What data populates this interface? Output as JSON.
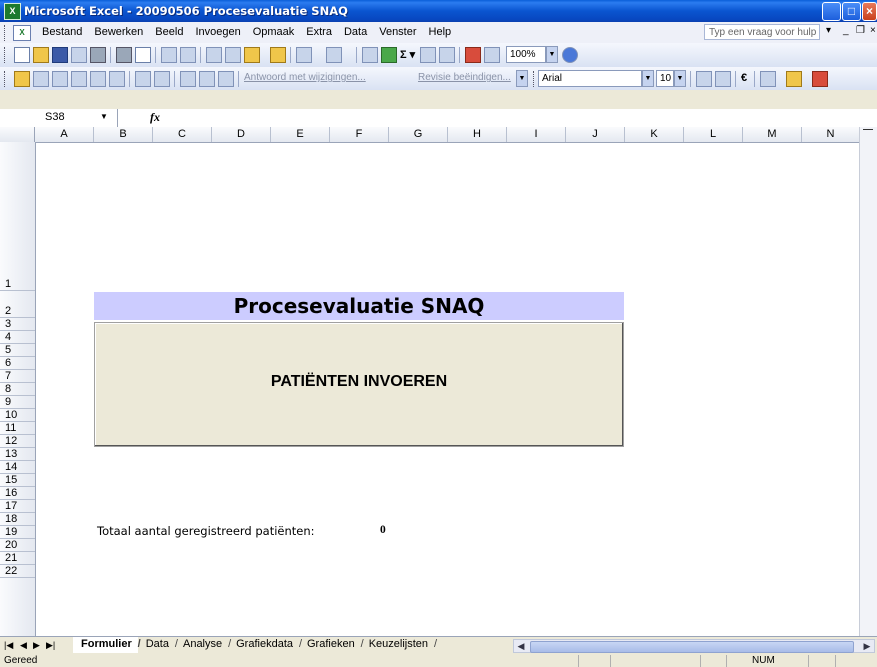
{
  "window": {
    "title": "Microsoft Excel - 20090506 Procesevaluatie SNAQ",
    "app_icon": "excel-icon"
  },
  "menu": {
    "items": [
      "Bestand",
      "Bewerken",
      "Beeld",
      "Invoegen",
      "Opmaak",
      "Extra",
      "Data",
      "Venster",
      "Help"
    ],
    "help_placeholder": "Typ een vraag voor hulp"
  },
  "toolbar_standard": {
    "zoom": "100%"
  },
  "toolbar_review": {
    "reply_label": "Antwoord met wijzigingen...",
    "end_review_label": "Revisie beëindigen..."
  },
  "toolbar_format": {
    "font": "Arial",
    "size": "10",
    "currency": "€"
  },
  "formula_bar": {
    "name_box": "S38",
    "fx": "fx",
    "formula": ""
  },
  "columns": [
    "A",
    "B",
    "C",
    "D",
    "E",
    "F",
    "G",
    "H",
    "I",
    "J",
    "K",
    "L",
    "M",
    "N"
  ],
  "rows": [
    "1",
    "2",
    "3",
    "4",
    "5",
    "6",
    "7",
    "8",
    "9",
    "10",
    "11",
    "12",
    "13",
    "14",
    "15",
    "16",
    "17",
    "18",
    "19",
    "20",
    "21",
    "22"
  ],
  "sheet": {
    "title": "Procesevaluatie SNAQ",
    "button_label": "PATIËNTEN INVOEREN",
    "total_label": "Totaal aantal geregistreerd patiënten:",
    "total_value": "0"
  },
  "tabs": [
    "Formulier",
    "Data",
    "Analyse",
    "Grafiekdata",
    "Grafieken",
    "Keuzelijsten"
  ],
  "active_tab": "Formulier",
  "status": {
    "text": "Gereed",
    "num": "NUM"
  }
}
